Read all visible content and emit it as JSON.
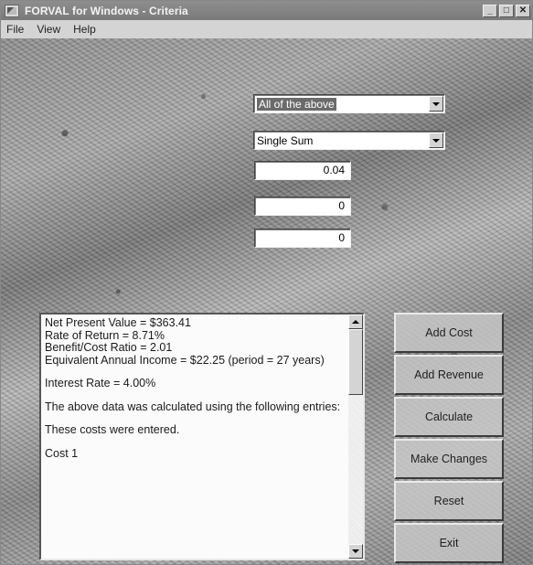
{
  "window": {
    "title": "FORVAL for Windows - Criteria",
    "controls": [
      "minimize-icon",
      "maximize-icon",
      "close-icon"
    ]
  },
  "menu": [
    "File",
    "View",
    "Help"
  ],
  "inputs": {
    "criteria_select": "All of the above",
    "cashflow_type_select": "Single Sum",
    "field_1": "0.04",
    "field_2": "0",
    "field_3": "0"
  },
  "results": {
    "lines": [
      "Net Present Value = $363.41",
      "Rate of Return = 8.71%",
      "Benefit/Cost Ratio = 2.01",
      "Equivalent Annual Income = $22.25 (period = 27 years)",
      "",
      "Interest Rate = 4.00%",
      "",
      "The above data was calculated using the following entries:",
      "",
      "These costs were entered.",
      "",
      "Cost 1"
    ]
  },
  "buttons": {
    "add_cost": "Add Cost",
    "add_revenue": "Add Revenue",
    "calculate": "Calculate",
    "make_changes": "Make Changes",
    "reset": "Reset",
    "exit": "Exit"
  },
  "colors": {
    "titlebar": "#7f7f7f",
    "selection": "#6b6b6b",
    "button_face": "#c8c8c8",
    "field_bg": "#ffffff"
  }
}
